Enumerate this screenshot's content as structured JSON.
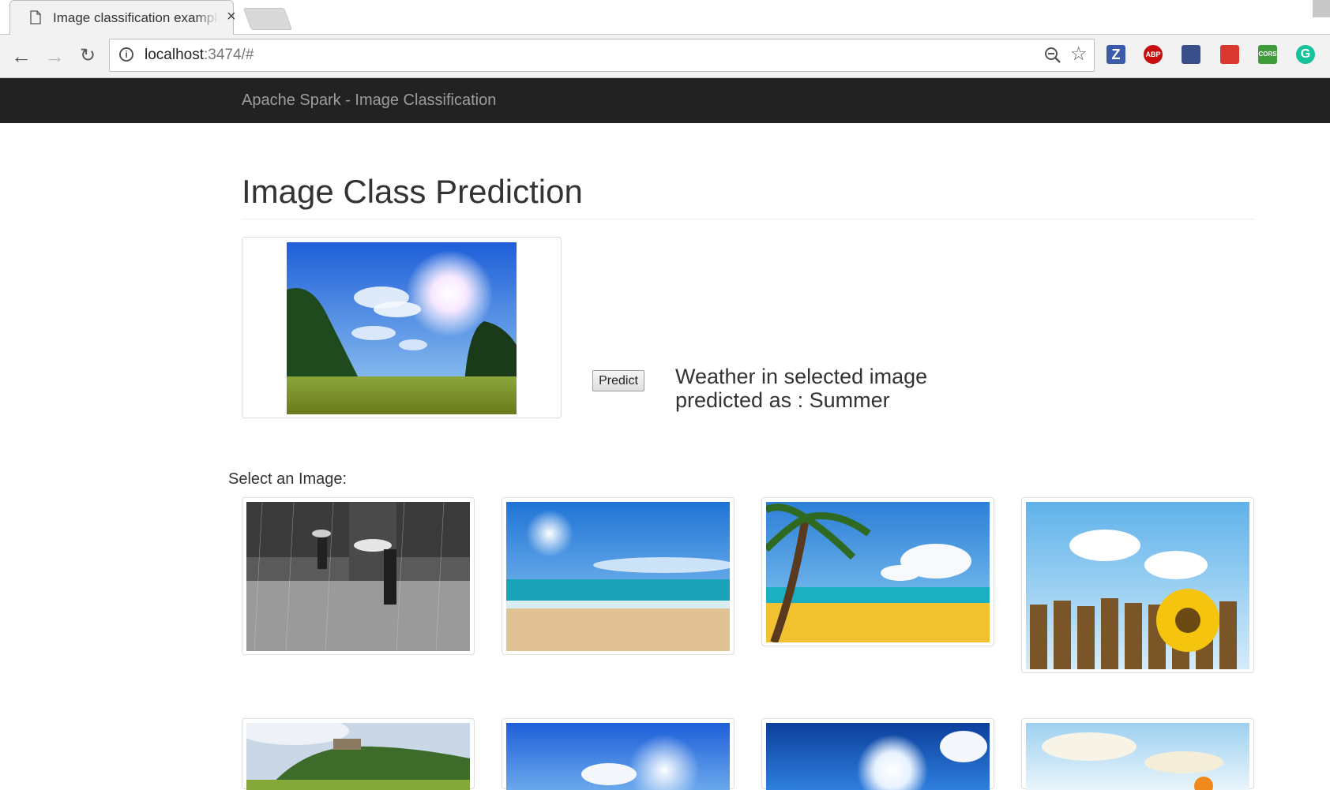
{
  "browser": {
    "tab_title": "Image classification example",
    "tab_close": "×",
    "url_host": "localhost",
    "url_rest": ":3474/#",
    "extensions": [
      "Z",
      "ABP",
      "globe",
      "book",
      "CORS",
      "G"
    ]
  },
  "navbar": {
    "brand": "Apache Spark - Image Classification"
  },
  "main": {
    "title": "Image Class Prediction",
    "selected_image": "sunny-meadow",
    "predict_label": "Predict",
    "result_line1": "Weather in selected image",
    "result_line2": "predicted as : Summer",
    "select_label": "Select an Image:"
  },
  "gallery": [
    {
      "name": "rain-street"
    },
    {
      "name": "beach-sun"
    },
    {
      "name": "palm-beach"
    },
    {
      "name": "sunflower-fence"
    },
    {
      "name": "castle-hill"
    },
    {
      "name": "sunny-sky"
    },
    {
      "name": "bright-sun"
    },
    {
      "name": "autumn-sky"
    }
  ],
  "colors": {
    "navbar_bg": "#222222",
    "brand_text": "#9d9d9d"
  }
}
